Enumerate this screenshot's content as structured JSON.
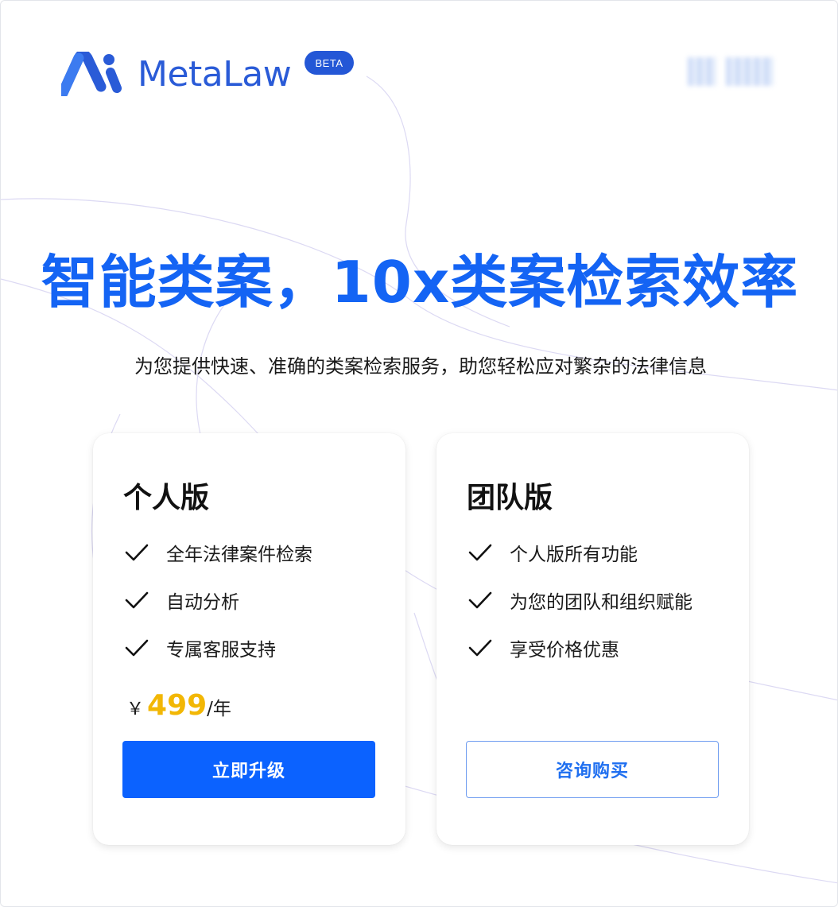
{
  "header": {
    "brand_name": "MetaLaw",
    "beta_badge": "BETA"
  },
  "hero": {
    "title": "智能类案，10x类案检索效率",
    "subtitle": "为您提供快速、准确的类案检索服务，助您轻松应对繁杂的法律信息"
  },
  "plans": {
    "personal": {
      "title": "个人版",
      "features": [
        "全年法律案件检索",
        "自动分析",
        "专属客服支持"
      ],
      "price": {
        "currency": "￥",
        "amount": "499",
        "unit": "/年"
      },
      "button_label": "立即升级"
    },
    "team": {
      "title": "团队版",
      "features": [
        "个人版所有功能",
        "为您的团队和组织赋能",
        "享受价格优惠"
      ],
      "button_label": "咨询购买"
    }
  },
  "icons": {
    "brand_logo": "metalaw-logo-icon",
    "feature_check": "check-icon"
  },
  "colors": {
    "brand": "#2a5bd7",
    "hero_title": "#1464f4",
    "primary_button": "#0b62ff",
    "price": "#f2b705"
  }
}
